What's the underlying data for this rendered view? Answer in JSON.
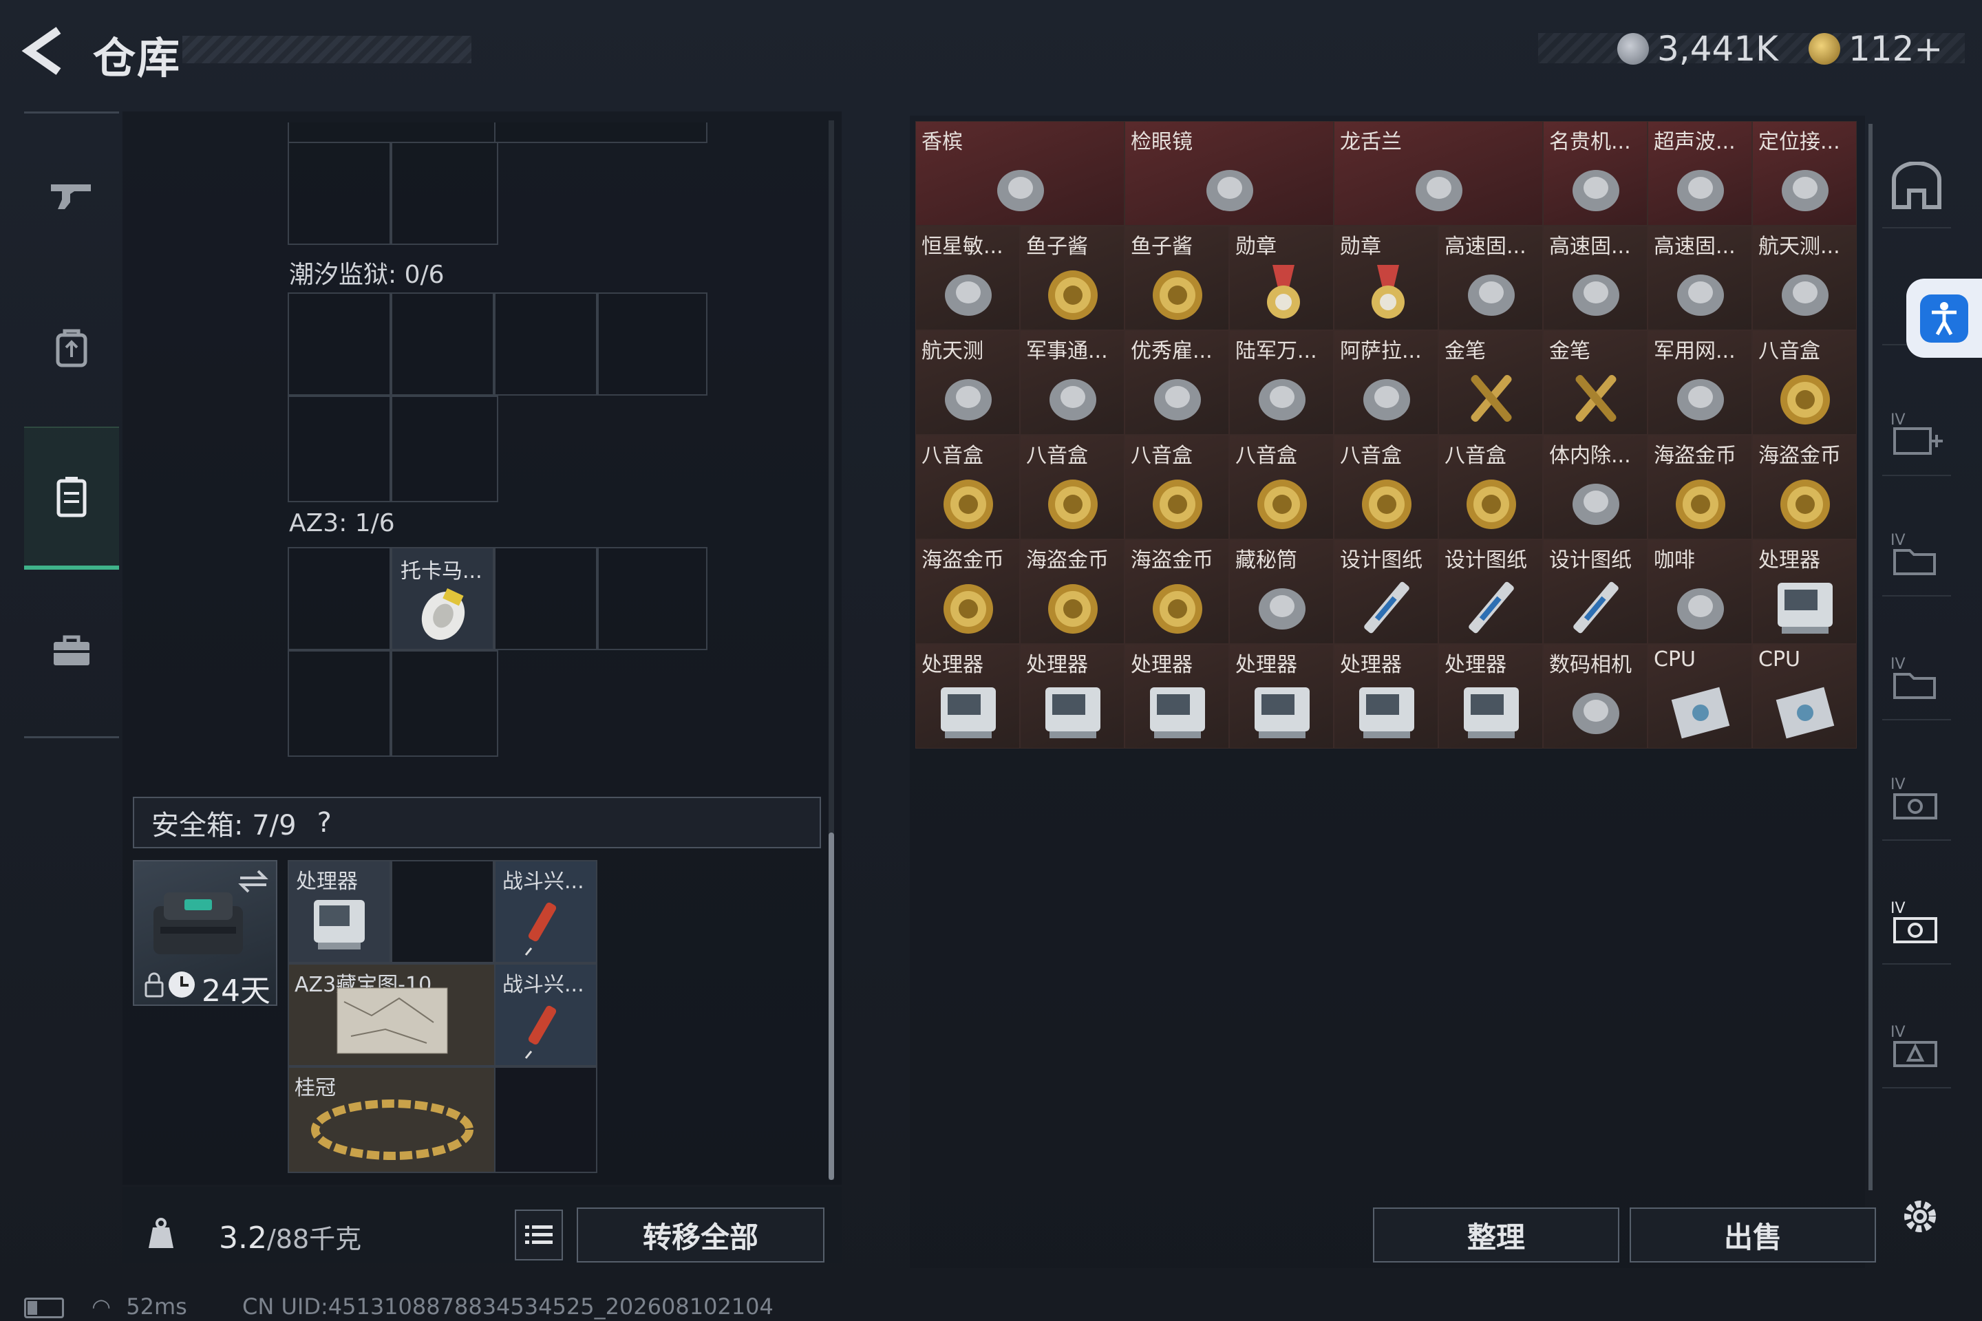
{
  "header": {
    "title": "仓库",
    "currency1": "3,441K",
    "currency2": "112+"
  },
  "left_nav": {
    "items": [
      "weapon",
      "backpack",
      "vest",
      "case"
    ],
    "active": "vest"
  },
  "containers": {
    "tide_prison_label": "潮汐监狱: 0/6",
    "az3_label": "AZ3: 1/6",
    "az3_item": "托卡马..."
  },
  "safebox": {
    "label": "安全箱: 7/9",
    "help": "?",
    "timer": "24天",
    "items": [
      {
        "name": "处理器"
      },
      {
        "name": "战斗兴..."
      },
      {
        "name": "AZ3藏宝图-10"
      },
      {
        "name": "战斗兴..."
      },
      {
        "name": "桂冠"
      }
    ]
  },
  "bottom_left": {
    "weight": "3.2",
    "weight_max": "/88千克",
    "transfer_all": "转移全部"
  },
  "stash_items": [
    {
      "name": "香槟",
      "span": 2,
      "red": true
    },
    {
      "name": "检眼镜",
      "span": 2,
      "red": true
    },
    {
      "name": "龙舌兰",
      "span": 2,
      "red": true
    },
    {
      "name": "名贵机...",
      "span": 1,
      "red": true
    },
    {
      "name": "超声波...",
      "span": 1,
      "red": true
    },
    {
      "name": "定位接...",
      "span": 1,
      "red": true
    },
    {
      "name": "恒星敏..."
    },
    {
      "name": "鱼子酱"
    },
    {
      "name": "鱼子酱"
    },
    {
      "name": "勋章"
    },
    {
      "name": "勋章"
    },
    {
      "name": "高速固..."
    },
    {
      "name": "高速固..."
    },
    {
      "name": "高速固..."
    },
    {
      "name": "航天测..."
    },
    {
      "name": "航天测"
    },
    {
      "name": "军事通..."
    },
    {
      "name": "优秀雇..."
    },
    {
      "name": "陆军万..."
    },
    {
      "name": "阿萨拉..."
    },
    {
      "name": "金笔"
    },
    {
      "name": "金笔"
    },
    {
      "name": "军用网..."
    },
    {
      "name": "八音盒"
    },
    {
      "name": "八音盒"
    },
    {
      "name": "八音盒"
    },
    {
      "name": "八音盒"
    },
    {
      "name": "八音盒"
    },
    {
      "name": "八音盒"
    },
    {
      "name": "八音盒"
    },
    {
      "name": "体内除..."
    },
    {
      "name": "海盗金币"
    },
    {
      "name": "海盗金币"
    },
    {
      "name": "海盗金币"
    },
    {
      "name": "海盗金币"
    },
    {
      "name": "海盗金币"
    },
    {
      "name": "藏秘筒"
    },
    {
      "name": "设计图纸"
    },
    {
      "name": "设计图纸"
    },
    {
      "name": "设计图纸"
    },
    {
      "name": "咖啡"
    },
    {
      "name": "处理器"
    },
    {
      "name": "处理器"
    },
    {
      "name": "处理器"
    },
    {
      "name": "处理器"
    },
    {
      "name": "处理器"
    },
    {
      "name": "处理器"
    },
    {
      "name": "处理器"
    },
    {
      "name": "数码相机"
    },
    {
      "name": "CPU"
    },
    {
      "name": "CPU"
    }
  ],
  "bottom_right": {
    "sort": "整理",
    "sell": "出售"
  },
  "right_tabs": [
    "home",
    "II",
    "IV-add",
    "IV",
    "IV",
    "IV",
    "IV",
    "IV"
  ],
  "status_bar": {
    "ping": "52ms",
    "uid": "CN UID:4513108878834534525_202608102104"
  },
  "colors": {
    "accent": "#3fb38a",
    "rare": "#5a2a2c",
    "gold": "#c9a24a"
  }
}
